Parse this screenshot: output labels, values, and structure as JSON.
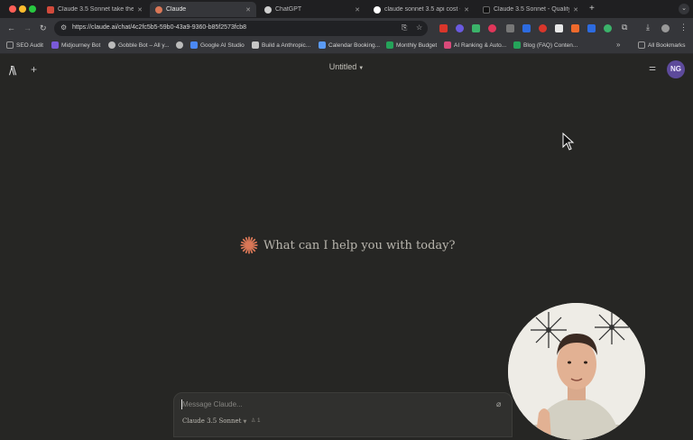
{
  "browser": {
    "tabs": [
      {
        "title": "Claude 3.5 Sonnet take the t",
        "favicon_color": "#d24a3b"
      },
      {
        "title": "Claude",
        "favicon_color": "#d97757"
      },
      {
        "title": "ChatGPT",
        "favicon_color": "#cfcfcf"
      },
      {
        "title": "claude sonnet 3.5 api cost -",
        "favicon_color": "#ffffff"
      },
      {
        "title": "Claude 3.5 Sonnet - Quality,",
        "favicon_color": "#111111"
      }
    ],
    "url": "https://claude.ai/chat/4c2fc5b5-59b0-43a9-9360-b85f2573fcb8",
    "bookmarks": [
      {
        "label": "SEO Audit",
        "color": "#9a9a9a"
      },
      {
        "label": "Midjourney Bot",
        "color": "#7a5ad8"
      },
      {
        "label": "Gobble Bot – All y...",
        "color": "#bbbbbb"
      },
      {
        "label": "",
        "color": "#bbbbbb"
      },
      {
        "label": "Google AI Studio",
        "color": "#4b89f5"
      },
      {
        "label": "Build a Anthropic...",
        "color": "#c7c7c7"
      },
      {
        "label": "Calendar Booking...",
        "color": "#5b9bf5"
      },
      {
        "label": "Monthly Budget",
        "color": "#25a35a"
      },
      {
        "label": "AI Ranking & Auto...",
        "color": "#d94a7a"
      },
      {
        "label": "Blog (FAQ) Conten...",
        "color": "#25a35a"
      }
    ],
    "all_bookmarks": "All Bookmarks"
  },
  "app": {
    "title": "Untitled",
    "avatar_initials": "NG",
    "greeting": "What can I help you with today?",
    "composer": {
      "placeholder": "Message Claude...",
      "model": "Claude 3.5 Sonnet",
      "attachments": "1"
    }
  },
  "colors": {
    "accent": "#d97757",
    "background": "#262624",
    "avatar": "#5d4a9b"
  }
}
